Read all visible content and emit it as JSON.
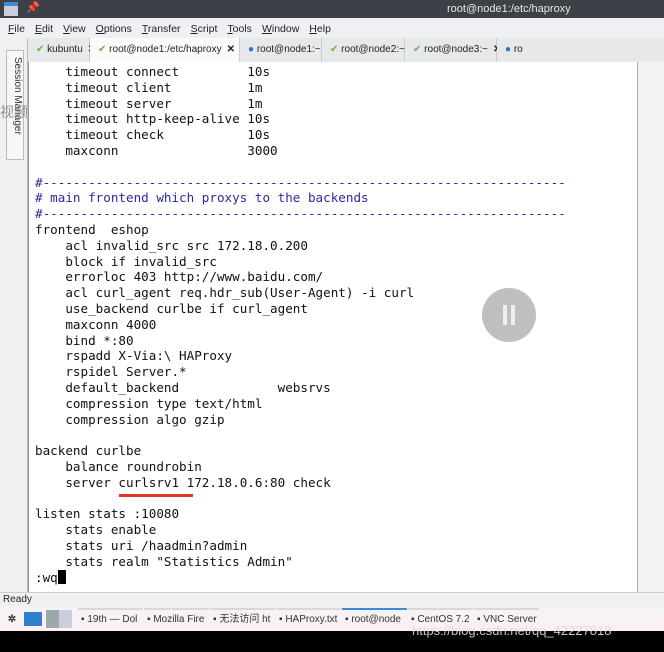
{
  "window": {
    "title": "root@node1:/etc/haproxy"
  },
  "menu": [
    "File",
    "Edit",
    "View",
    "Options",
    "Transfer",
    "Script",
    "Tools",
    "Window",
    "Help"
  ],
  "tabs": [
    {
      "label": "kubuntu",
      "status": "ok"
    },
    {
      "label": "root@node1:/etc/haproxy",
      "status": "ok",
      "active": true
    },
    {
      "label": "root@node1:~",
      "status": "info"
    },
    {
      "label": "root@node2:~",
      "status": "ok"
    },
    {
      "label": "root@node3:~",
      "status": "ok"
    },
    {
      "label": "ro",
      "status": "info"
    }
  ],
  "side_label": "Session Manager",
  "terminal_lines": [
    "    timeout connect         10s",
    "    timeout client          1m",
    "    timeout server          1m",
    "    timeout http-keep-alive 10s",
    "    timeout check           10s",
    "    maxconn                 3000",
    "",
    "#---------------------------------------------------------------------",
    "# main frontend which proxys to the backends",
    "#---------------------------------------------------------------------",
    "frontend  eshop",
    "    acl invalid_src src 172.18.0.200",
    "    block if invalid_src",
    "    errorloc 403 http://www.baidu.com/",
    "    acl curl_agent req.hdr_sub(User-Agent) -i curl",
    "    use_backend curlbe if curl_agent",
    "    maxconn 4000",
    "    bind *:80",
    "    rspadd X-Via:\\ HAProxy",
    "    rspidel Server.*",
    "    default_backend             websrvs",
    "    compression type text/html",
    "    compression algo gzip",
    "",
    "backend curlbe",
    "    balance roundrobin",
    "    server curlsrv1 172.18.0.6:80 check",
    "",
    "listen stats :10080",
    "    stats enable",
    "    stats uri /haadmin?admin",
    "    stats realm \"Statistics Admin\"",
    ":wq"
  ],
  "status": "Ready",
  "taskbar": [
    "19th — Dol",
    "Mozilla Fire",
    "无法访问 ht",
    "HAProxy.txt",
    "root@node",
    "CentOS 7.2",
    "VNC Server"
  ],
  "watermark": "https://blog.csdn.net/qq_42227818",
  "overlay_text": "视频"
}
